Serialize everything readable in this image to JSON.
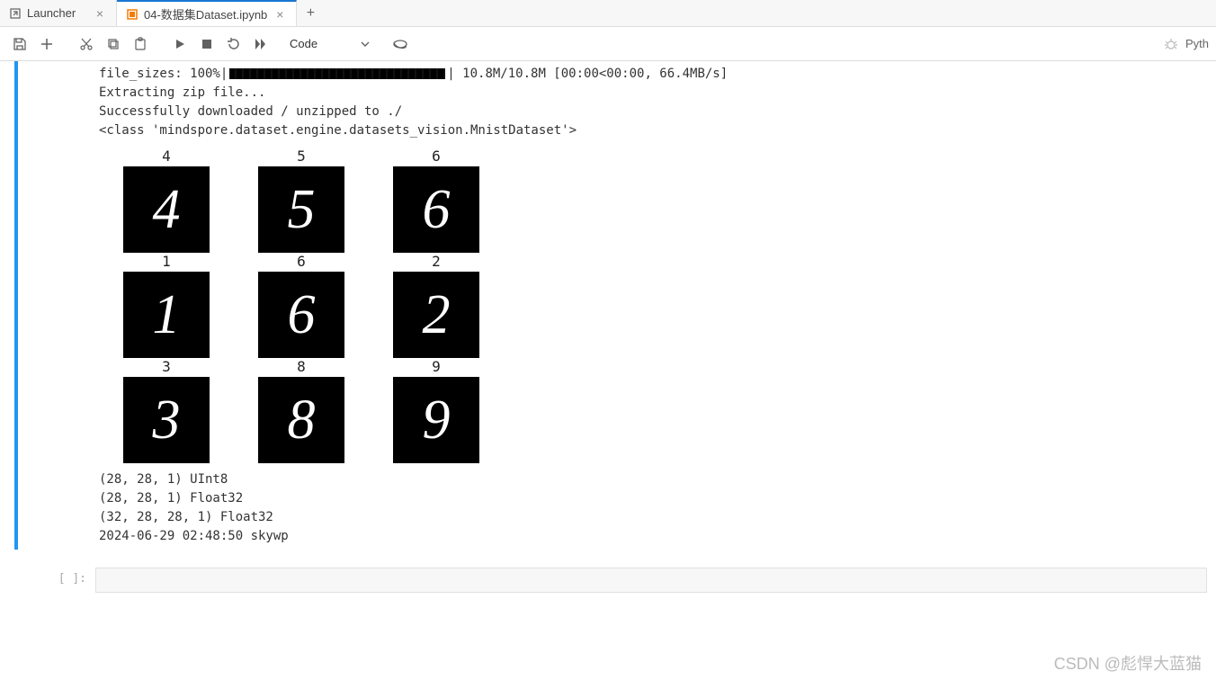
{
  "tabs": [
    {
      "label": "Launcher",
      "active": false,
      "icon": "external-icon"
    },
    {
      "label": "04-数据集Dataset.ipynb",
      "active": true,
      "icon": "notebook-icon"
    }
  ],
  "toolbar": {
    "celltype": "Code"
  },
  "kernel": {
    "name": "Pyth"
  },
  "output": {
    "line1_prefix": "file_sizes: 100%|",
    "line1_suffix": "| 10.8M/10.8M [00:00<00:00, 66.4MB/s]",
    "line2": "Extracting zip file...",
    "line3": "Successfully downloaded / unzipped to ./",
    "line4": "<class 'mindspore.dataset.engine.datasets_vision.MnistDataset'>",
    "shape1": "(28, 28, 1) UInt8",
    "shape2": "(28, 28, 1) Float32",
    "shape3": "(32, 28, 28, 1) Float32",
    "timestamp": "2024-06-29 02:48:50 skywp"
  },
  "mnist": {
    "labels": [
      "4",
      "5",
      "6",
      "1",
      "6",
      "2",
      "3",
      "8",
      "9"
    ],
    "digits": [
      "4",
      "5",
      "6",
      "1",
      "6",
      "2",
      "3",
      "8",
      "9"
    ]
  },
  "prompt": {
    "in": "[ ]:"
  },
  "watermark": "CSDN @彪悍大蓝猫"
}
